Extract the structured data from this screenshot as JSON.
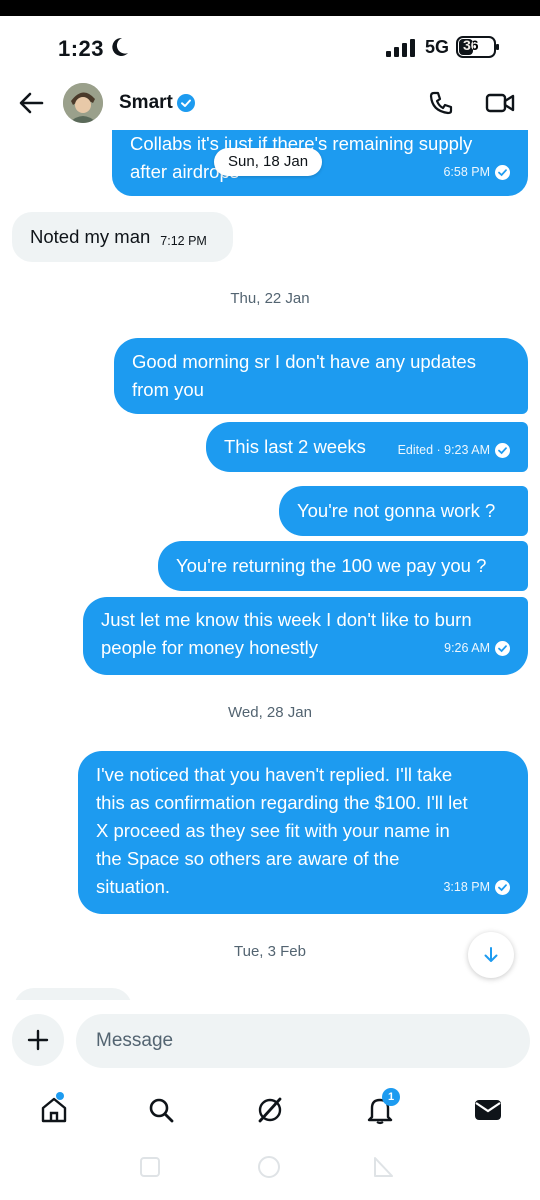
{
  "status_bar": {
    "time": "1:23",
    "network": "5G",
    "battery": "36"
  },
  "header": {
    "contact_name": "Smart"
  },
  "chat": {
    "pinned_date": "Sun, 18 Jan",
    "partial_bubble": {
      "line1": "Collabs it's just if there's remaining supply",
      "line2": "after airdrops",
      "time": "6:58 PM"
    },
    "incoming_1": {
      "text": "Noted my man",
      "time": "7:12 PM"
    },
    "date_1": "Thu, 22 Jan",
    "msg_1": {
      "line1": "Good morning sr I don't have any updates",
      "line2": "from you"
    },
    "msg_2": {
      "text": "This last 2 weeks",
      "status": "Edited · 9:23 AM"
    },
    "msg_3": {
      "text": "You're not gonna work ?"
    },
    "msg_4": {
      "text": "You're returning the 100 we pay you ?"
    },
    "msg_5": {
      "line1": "Just let me know this week I don't like to burn",
      "line2": "people for money honestly",
      "time": "9:26 AM"
    },
    "date_2": "Wed, 28 Jan",
    "msg_6": {
      "line1": "I've noticed that you haven't replied. I'll take",
      "line2": "this as confirmation regarding the $100. I'll let",
      "line3": "X proceed as they see fit with your name in",
      "line4": "the Space so others are aware of the",
      "line5": "situation.",
      "time": "3:18 PM"
    },
    "date_3": "Tue, 3 Feb"
  },
  "composer": {
    "placeholder": "Message"
  },
  "nav": {
    "notifications_count": "1"
  },
  "colors": {
    "accent": "#1d9bf0",
    "incoming_bg": "#eff3f4",
    "muted_text": "#536471"
  }
}
